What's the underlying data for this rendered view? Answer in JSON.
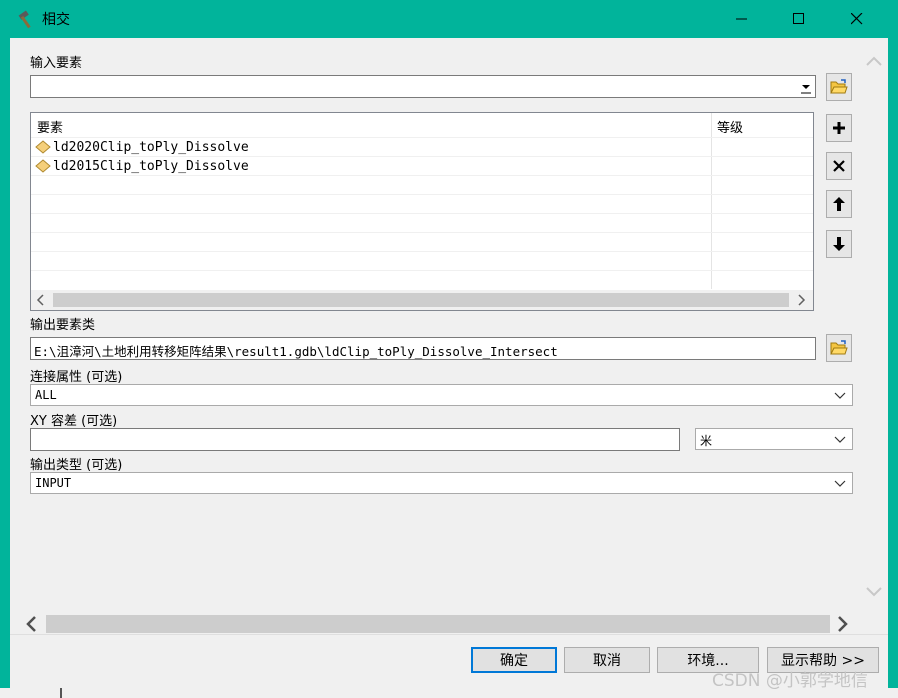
{
  "window": {
    "title": "相交",
    "minimize": "—",
    "maximize": "☐",
    "close": "✕"
  },
  "input_features": {
    "label": "输入要素",
    "value": "",
    "list_header_features": "要素",
    "list_header_rank": "等级",
    "items": [
      {
        "name": "ld2020Clip_toPly_Dissolve",
        "rank": ""
      },
      {
        "name": "ld2015Clip_toPly_Dissolve",
        "rank": ""
      }
    ]
  },
  "output_feature_class": {
    "label": "输出要素类",
    "value": "E:\\沮漳河\\土地利用转移矩阵结果\\result1.gdb\\ldClip_toPly_Dissolve_Intersect"
  },
  "join_attributes": {
    "label": "连接属性 (可选)",
    "value": "ALL"
  },
  "xy_tolerance": {
    "label": "XY 容差 (可选)",
    "value": "",
    "unit": "米"
  },
  "output_type": {
    "label": "输出类型 (可选)",
    "value": "INPUT"
  },
  "buttons": {
    "ok": "确定",
    "cancel": "取消",
    "environments": "环境...",
    "show_help": "显示帮助 >>"
  },
  "watermark": "CSDN @小郭学地信"
}
